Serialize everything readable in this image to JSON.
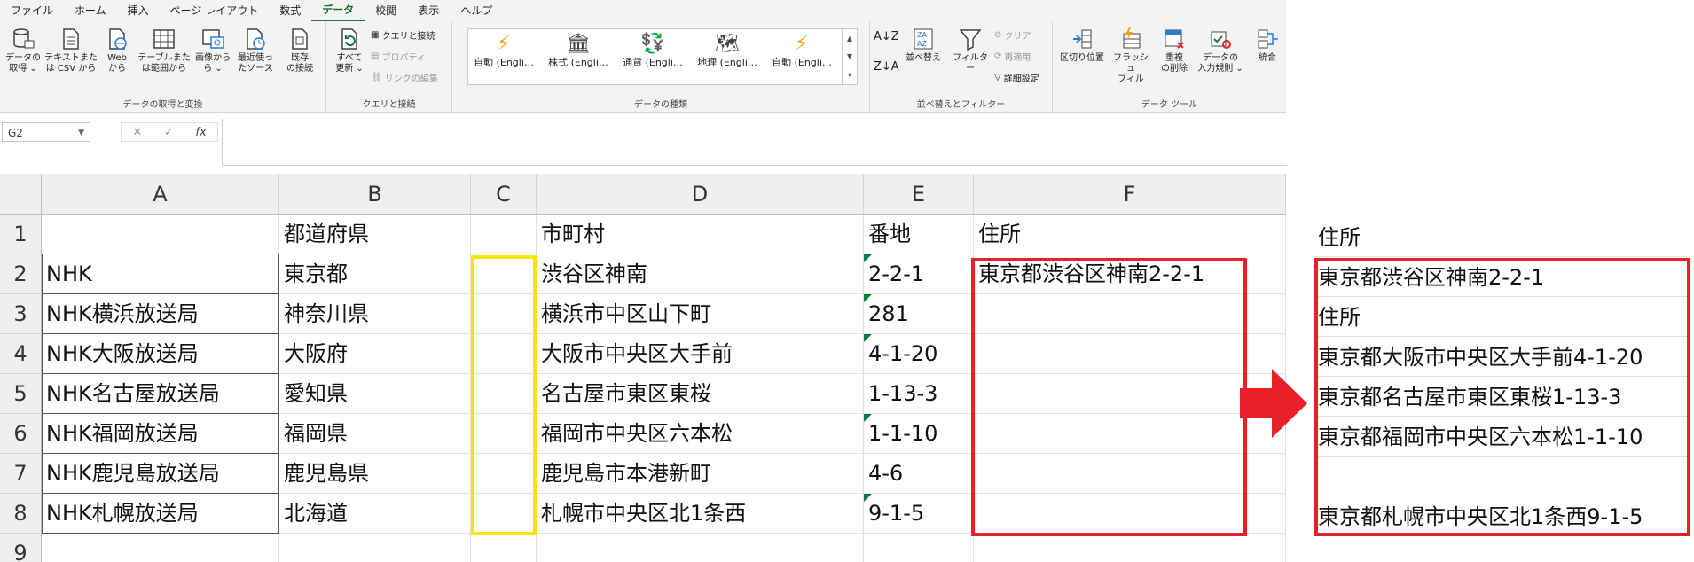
{
  "ribbon_tabs": [
    "ファイル",
    "ホーム",
    "挿入",
    "ページ レイアウト",
    "数式",
    "データ",
    "校閲",
    "表示",
    "ヘルプ"
  ],
  "active_tab": "データ",
  "groups": {
    "get_transform": {
      "label": "データの取得と変換",
      "buttons": [
        {
          "l1": "データの",
          "l2": "取得 ⌄"
        },
        {
          "l1": "テキストまた",
          "l2": "は CSV から"
        },
        {
          "l1": "Web",
          "l2": "から"
        },
        {
          "l1": "テーブルまた",
          "l2": "は範囲から"
        },
        {
          "l1": "画像から",
          "l2": "ら ⌄"
        },
        {
          "l1": "最近使っ",
          "l2": "たソース"
        },
        {
          "l1": "既存",
          "l2": "の接続"
        }
      ]
    },
    "queries": {
      "label": "クエリと接続",
      "refresh": {
        "l1": "すべて",
        "l2": "更新 ⌄"
      },
      "items": [
        "クエリと接続",
        "プロパティ",
        "リンクの編集"
      ]
    },
    "datatypes": {
      "label": "データの種類",
      "items": [
        "自動 (Engli…",
        "株式 (Engli…",
        "通貨 (Engli…",
        "地理 (Engli…",
        "自動 (Engli…"
      ]
    },
    "sort_filter": {
      "label": "並べ替えとフィルター",
      "sort": "並べ替え",
      "filter": "フィルター",
      "clear": "クリア",
      "reapply": "再適用",
      "advanced": "詳細設定"
    },
    "data_tools": {
      "label": "データ ツール",
      "buttons": [
        {
          "l1": "区切り位置",
          "l2": ""
        },
        {
          "l1": "フラッシュ",
          "l2": "フィル"
        },
        {
          "l1": "重複",
          "l2": "の削除"
        },
        {
          "l1": "データの",
          "l2": "入力規則 ⌄"
        },
        {
          "l1": "統合",
          "l2": ""
        }
      ]
    }
  },
  "formula_bar": {
    "name_box": "G2",
    "formula": ""
  },
  "columns": [
    "A",
    "B",
    "C",
    "D",
    "E",
    "F"
  ],
  "row_numbers": [
    "1",
    "2",
    "3",
    "4",
    "5",
    "6",
    "7",
    "8",
    "9"
  ],
  "rows": [
    [
      "",
      "都道府県",
      "",
      "市町村",
      "番地",
      "住所"
    ],
    [
      "NHK",
      "東京都",
      "",
      "渋谷区神南",
      "2-2-1",
      "東京都渋谷区神南2-2-1"
    ],
    [
      "NHK横浜放送局",
      "神奈川県",
      "",
      "横浜市中区山下町",
      "281",
      ""
    ],
    [
      "NHK大阪放送局",
      "大阪府",
      "",
      "大阪市中央区大手前",
      "4-1-20",
      ""
    ],
    [
      "NHK名古屋放送局",
      "愛知県",
      "",
      "名古屋市東区東桜",
      "1-13-3",
      ""
    ],
    [
      "NHK福岡放送局",
      "福岡県",
      "",
      "福岡市中央区六本松",
      "1-1-10",
      ""
    ],
    [
      "NHK鹿児島放送局",
      "鹿児島県",
      "",
      "鹿児島市本港新町",
      "4-6",
      ""
    ],
    [
      "NHK札幌放送局",
      "北海道",
      "",
      "札幌市中央区北1条西",
      "9-1-5",
      ""
    ],
    [
      "",
      "",
      "",
      "",
      "",
      ""
    ]
  ],
  "result_panel": {
    "header": "住所",
    "lines": [
      "東京都渋谷区神南2-2-1",
      "住所",
      "東京都大阪市中央区大手前4-1-20",
      "東京都名古屋市東区東桜1-13-3",
      "東京都福岡市中央区六本松1-1-10",
      "",
      "東京都札幌市中央区北1条西9-1-5"
    ]
  },
  "colors": {
    "accent": "#217346",
    "yellow_highlight": "#f5e50c",
    "red_highlight": "#e8202a"
  }
}
